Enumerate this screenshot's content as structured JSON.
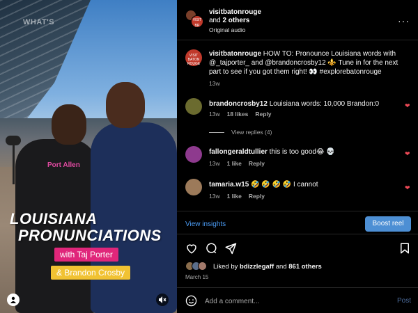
{
  "media": {
    "watermark": "WHAT'S",
    "title_line1": "LOUISIANA",
    "title_line2": "PRONUNCIATIONS",
    "tag1": "with Taj Porter",
    "tag2": "& Brandon Crosby",
    "shirt_text": "Port Allen"
  },
  "header": {
    "username": "visitbatonrouge",
    "others_prefix": "and ",
    "others_count": "2 others",
    "audio": "Original audio",
    "more": "···"
  },
  "caption": {
    "username": "visitbatonrouge",
    "text": " HOW TO: Pronounce Louisiana words with @_tajporter_ and @brandoncrosby12 ⚜️ Tune in for the next part to see if you got them right! 👀 #explorebatonrouge",
    "time": "13w"
  },
  "comments": [
    {
      "username": "brandoncrosby12",
      "text": " Louisiana words: 10,000 Brandon:0",
      "time": "13w",
      "likes": "18 likes",
      "reply": "Reply",
      "avatar_color": "#6b6b2f"
    },
    {
      "username": "fallongeraldtullier",
      "text": " this is too good😂 💀",
      "time": "13w",
      "likes": "1 like",
      "reply": "Reply",
      "avatar_color": "#8e3a8e"
    },
    {
      "username": "tamaria.w15",
      "text": " 🤣 🤣 🤣 🤣 I cannot",
      "time": "13w",
      "likes": "1 like",
      "reply": "Reply",
      "avatar_color": "#9c7a5a"
    }
  ],
  "view_replies": "View replies (4)",
  "insights": {
    "view_insights": "View insights",
    "boost": "Boost reel"
  },
  "likes": {
    "prefix": "Liked by ",
    "user": "bdizzlegaff",
    "middle": " and ",
    "others": "861 others"
  },
  "date": "March 15",
  "add_comment": {
    "placeholder": "Add a comment...",
    "post": "Post"
  },
  "colors": {
    "heart": "#ed4956",
    "link": "#4b9cf5",
    "boost": "#4d8fd4"
  }
}
